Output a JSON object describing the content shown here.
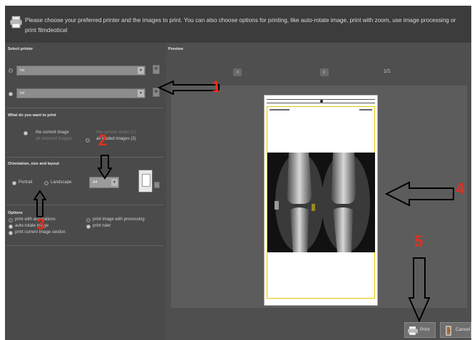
{
  "header": {
    "icon": "printer-icon",
    "instructions": "Please choose your preferred printer and the images to print. You can also choose options for printing, like auto-rotate image, print with zoom, use image processing or print filmdeotical"
  },
  "printer_section": {
    "title": "Select printer",
    "printers": [
      {
        "value": "hd",
        "selected": false
      },
      {
        "value": "hd",
        "selected": true
      }
    ]
  },
  "print_what_section": {
    "title": "What do you want to print",
    "options": [
      {
        "label": "the current image",
        "selected": true,
        "enabled": true
      },
      {
        "label": "all selected images",
        "selected": false,
        "enabled": false
      },
      {
        "label": "the current series (1)",
        "selected": false,
        "enabled": false
      },
      {
        "label": "all loaded images (3)",
        "selected": false,
        "enabled": true
      }
    ]
  },
  "layout_section": {
    "title": "Orientation, size and layout",
    "orientations": [
      {
        "label": "Portrait",
        "selected": true
      },
      {
        "label": "Landscape",
        "selected": false
      }
    ],
    "paper_size": "A4"
  },
  "options_section": {
    "title": "Options",
    "options": [
      {
        "label": "print with annotations",
        "checked": false
      },
      {
        "label": "print image with processing",
        "checked": false
      },
      {
        "label": "auto-rotate image",
        "checked": true
      },
      {
        "label": "print ruler",
        "checked": true
      },
      {
        "label": "print current image section",
        "checked": true
      }
    ]
  },
  "preview": {
    "title": "Preview",
    "page_count": "1/1"
  },
  "buttons": {
    "print": "Print",
    "cancel": "Cancel"
  },
  "annotations": [
    "1",
    "2",
    "3",
    "4",
    "5"
  ],
  "colors": {
    "window_bg": "#4f4f4f",
    "preview_bg": "#5c5c5c",
    "annotation_red": "#e03020",
    "paper_frame": "#e6c700"
  }
}
